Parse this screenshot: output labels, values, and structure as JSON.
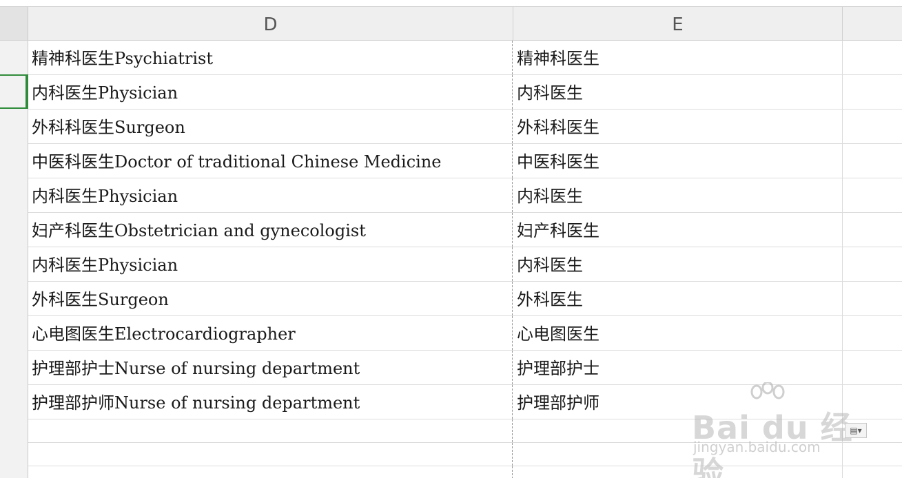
{
  "columns": {
    "d": "D",
    "e": "E"
  },
  "rows": [
    {
      "d": "精神科医生Psychiatrist",
      "e": "精神科医生"
    },
    {
      "d": "内科医生Physician",
      "e": "内科医生"
    },
    {
      "d": "外科科医生Surgeon",
      "e": "外科科医生"
    },
    {
      "d": "中医科医生Doctor of traditional Chinese Medicine",
      "e": "中医科医生"
    },
    {
      "d": "内科医生Physician",
      "e": "内科医生"
    },
    {
      "d": "妇产科医生Obstetrician and gynecologist",
      "e": "妇产科医生"
    },
    {
      "d": "内科医生Physician",
      "e": "内科医生"
    },
    {
      "d": "外科医生Surgeon",
      "e": "外科医生"
    },
    {
      "d": "心电图医生Electrocardiographer",
      "e": "心电图医生"
    },
    {
      "d": "护理部护士Nurse of nursing department",
      "e": "护理部护士"
    },
    {
      "d": "护理部护师Nurse of nursing department",
      "e": "护理部护师"
    }
  ],
  "watermark": {
    "logo": "Bai du 经验",
    "site": "jingyan.baidu.com"
  },
  "paste_options_icon": "paste-options-icon",
  "accent_color": "#2e8b3a"
}
